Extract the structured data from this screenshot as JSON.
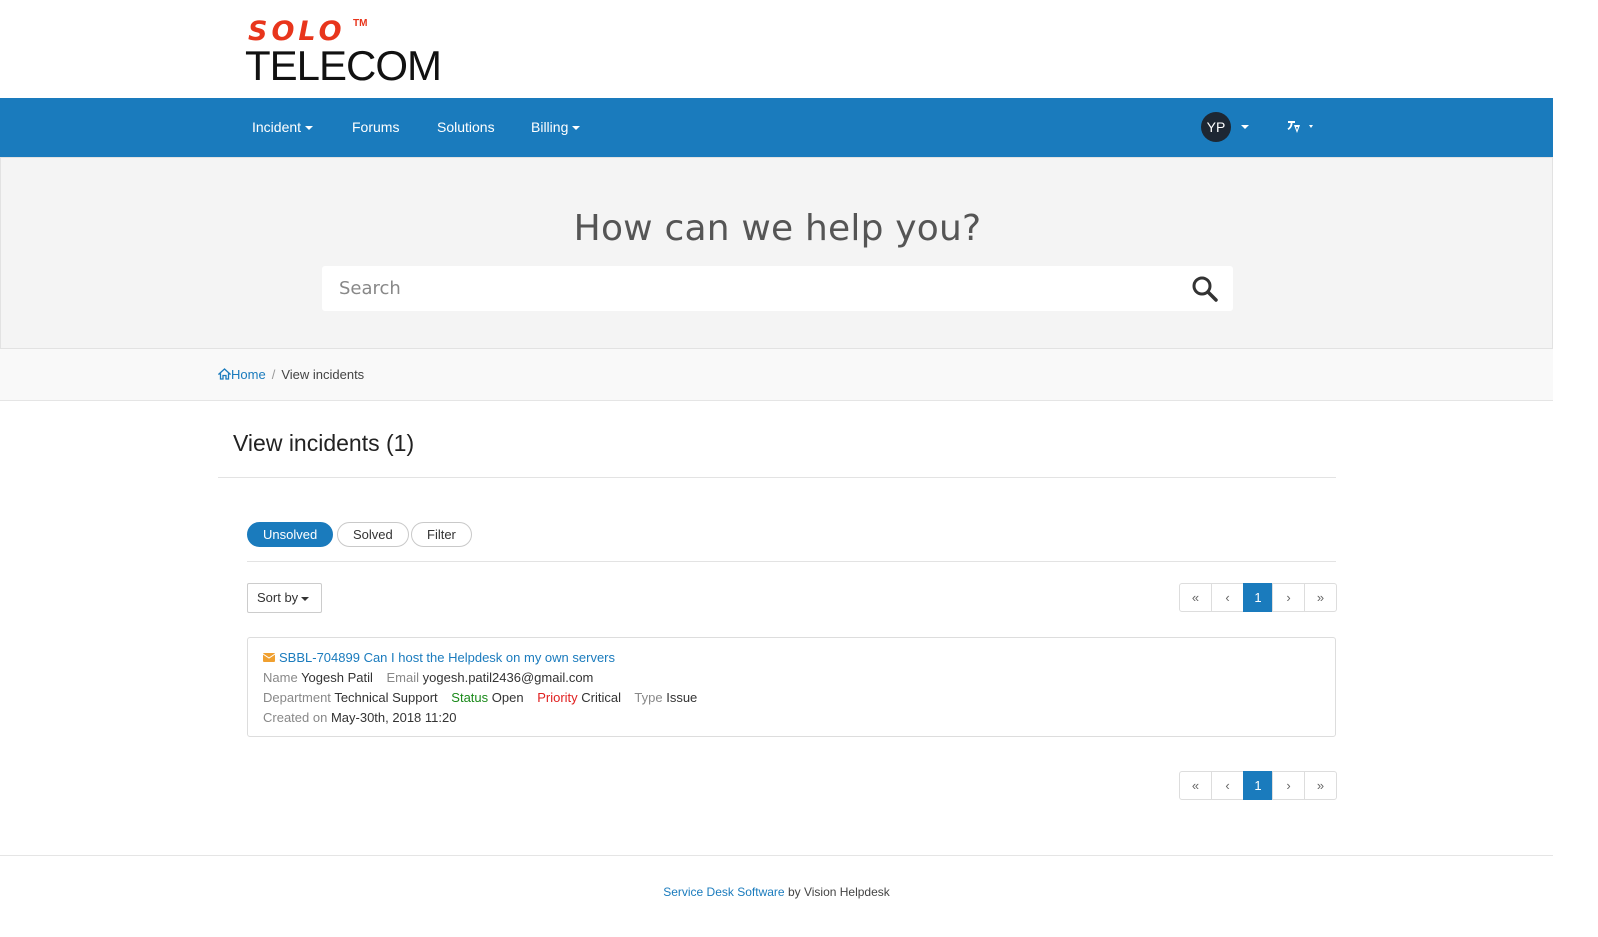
{
  "brand": {
    "logo_top": "SOLO",
    "logo_tm": "TM",
    "logo_bottom": "TELECOM"
  },
  "nav": {
    "items": [
      {
        "label": "Incident",
        "dropdown": true
      },
      {
        "label": "Forums",
        "dropdown": false
      },
      {
        "label": "Solutions",
        "dropdown": false
      },
      {
        "label": "Billing",
        "dropdown": true
      }
    ],
    "avatar_initials": "YP"
  },
  "hero": {
    "title": "How can we help you?",
    "search_placeholder": "Search"
  },
  "breadcrumb": {
    "home": "Home",
    "current": "View incidents"
  },
  "main": {
    "title": "View incidents (1)",
    "filters": [
      "Unsolved",
      "Solved",
      "Filter"
    ],
    "sort_label": "Sort by",
    "pagination": {
      "current": "1"
    }
  },
  "incident": {
    "subject": "SBBL-704899 Can I host the Helpdesk on my own servers",
    "name_label": "Name",
    "name": "Yogesh Patil",
    "email_label": "Email",
    "email": "yogesh.patil2436@gmail.com",
    "department_label": "Department",
    "department": "Technical Support",
    "status_label": "Status",
    "status": "Open",
    "priority_label": "Priority",
    "priority": "Critical",
    "type_label": "Type",
    "type": "Issue",
    "created_label": "Created on",
    "created": "May-30th, 2018 11:20"
  },
  "footer": {
    "link": "Service Desk Software",
    "text": "by Vision Helpdesk"
  },
  "colors": {
    "primary": "#1a7bbd",
    "status": "#1a8a1a",
    "priority": "#e02020",
    "logo_red": "#e8351c"
  }
}
